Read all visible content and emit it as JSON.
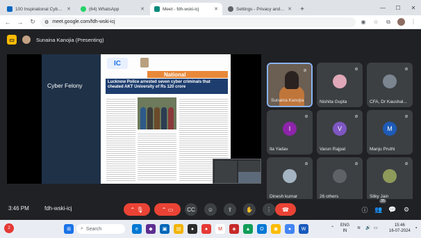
{
  "browser": {
    "tabs": [
      {
        "title": "100 Inspirational Cybersecurit",
        "favicon_color": "#0a66c2",
        "active": false
      },
      {
        "title": "(64) WhatsApp",
        "favicon_color": "#25d366",
        "active": false
      },
      {
        "title": "Meet - fdh-wski-icj",
        "favicon_color": "#00897b",
        "active": true
      },
      {
        "title": "Settings - Privacy and security",
        "favicon_color": "#5f6368",
        "active": false
      }
    ],
    "url": "meet.google.com/fdh-wski-icj"
  },
  "meet": {
    "presenting_text": "Sunaina Kanojia (Presenting)",
    "slide": {
      "left_label": "Cyber Felony",
      "section": "National",
      "headline": "Lucknow Police arrested seven cyber criminals that cheated AKT University of Rs 120 crore"
    },
    "participants": [
      {
        "name": "Sunaina Kanojia",
        "initial": "",
        "color": "#6b5e52",
        "video": true,
        "speaking": true
      },
      {
        "name": "Nishita Gupta",
        "initial": "",
        "color": "#e0a8b8",
        "video": false,
        "speaking": false
      },
      {
        "name": "CFA, Dr Kaushal...",
        "initial": "",
        "color": "#7b8590",
        "video": false,
        "speaking": false
      },
      {
        "name": "Ila Yadav",
        "initial": "I",
        "color": "#8e24aa",
        "video": false,
        "speaking": false
      },
      {
        "name": "Varun Rajpal",
        "initial": "V",
        "color": "#7e57c2",
        "video": false,
        "speaking": false
      },
      {
        "name": "Manju Pruthi",
        "initial": "M",
        "color": "#1e5bb8",
        "video": false,
        "speaking": false
      },
      {
        "name": "Dinesh kumar",
        "initial": "",
        "color": "#a5b4c2",
        "video": false,
        "speaking": false
      },
      {
        "name": "26 others",
        "initial": "",
        "color": "#5f6368",
        "video": false,
        "speaking": false
      },
      {
        "name": "Silky Jain",
        "initial": "",
        "color": "#8d9a5a",
        "video": false,
        "speaking": false
      }
    ],
    "clock": "3:46 PM",
    "meeting_code": "fdh-wski-icj",
    "people_count": "35"
  },
  "taskbar": {
    "search_placeholder": "Search",
    "weather_badge": "2",
    "lang": "ENG",
    "lang_region": "IN",
    "time": "15:46",
    "date": "16-07-2024"
  },
  "icons": [
    "back-icon",
    "forward-icon",
    "reload-icon",
    "mic-off-icon",
    "camera-off-icon",
    "captions-icon",
    "emoji-icon",
    "present-icon",
    "raise-hand-icon",
    "more-icon",
    "leave-call-icon",
    "info-icon",
    "people-icon",
    "chat-icon",
    "activities-icon"
  ]
}
